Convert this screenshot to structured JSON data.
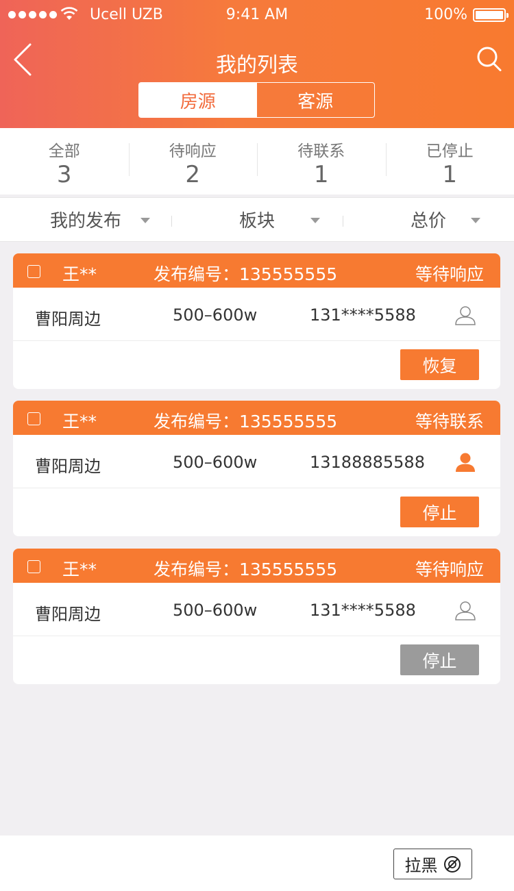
{
  "status_bar": {
    "carrier": "Ucell UZB",
    "time": "9:41 AM",
    "battery": "100%"
  },
  "nav": {
    "title": "我的列表",
    "back_icon": "chevron-left-icon",
    "search_icon": "search-icon"
  },
  "segment": {
    "tabs": [
      {
        "label": "房源",
        "active": true
      },
      {
        "label": "客源",
        "active": false
      }
    ]
  },
  "stats": [
    {
      "label": "全部",
      "count": "3"
    },
    {
      "label": "待响应",
      "count": "2"
    },
    {
      "label": "待联系",
      "count": "1"
    },
    {
      "label": "已停止",
      "count": "1"
    }
  ],
  "filters": [
    {
      "label": "我的发布"
    },
    {
      "label": "板块"
    },
    {
      "label": "总价"
    }
  ],
  "cards": [
    {
      "owner": "王**",
      "pub_no": "发布编号：135555555",
      "state": "等待响应",
      "area": "曹阳周边",
      "price": "500–600w",
      "phone": "131****5588",
      "contact_icon": "person-outline-icon",
      "action": "恢复",
      "action_color": "#f77a31"
    },
    {
      "owner": "王**",
      "pub_no": "发布编号：135555555",
      "state": "等待联系",
      "area": "曹阳周边",
      "price": "500–600w",
      "phone": "13188885588",
      "contact_icon": "person-filled-icon",
      "action": "停止",
      "action_color": "#f77a31"
    },
    {
      "owner": "王**",
      "pub_no": "发布编号：135555555",
      "state": "等待响应",
      "area": "曹阳周边",
      "price": "500–600w",
      "phone": "131****5588",
      "contact_icon": "person-outline-icon",
      "action": "停止",
      "action_color": "#9b9b9b"
    }
  ],
  "footer": {
    "block_label": "拉黑",
    "block_icon": "no-symbol-icon"
  },
  "colors": {
    "accent": "#f77a31",
    "header_gradient_start": "#ef6458",
    "disabled": "#9b9b9b"
  }
}
